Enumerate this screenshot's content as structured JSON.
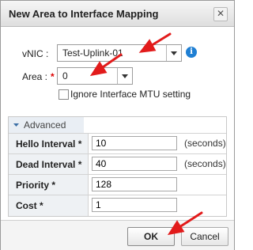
{
  "dialog": {
    "title": "New Area to Interface Mapping",
    "close_icon": "close-icon"
  },
  "form": {
    "vnic_label": "vNIC :",
    "vnic_value": "Test-Uplink-01",
    "area_label": "Area :",
    "area_required": "*",
    "area_value": "0",
    "ignore_mtu_label": "Ignore Interface MTU setting",
    "ignore_mtu_checked": false
  },
  "advanced": {
    "header": "Advanced",
    "expanded": true,
    "rows": [
      {
        "label": "Hello Interval *",
        "value": "10",
        "unit": "(seconds)"
      },
      {
        "label": "Dead Interval *",
        "value": "40",
        "unit": "(seconds)"
      },
      {
        "label": "Priority *",
        "value": "128",
        "unit": ""
      },
      {
        "label": "Cost *",
        "value": "1",
        "unit": ""
      }
    ]
  },
  "buttons": {
    "ok": "OK",
    "cancel": "Cancel"
  },
  "colors": {
    "accent_info": "#1f7fd3",
    "annotation_arrow": "#e21b1b",
    "required_marker": "#dd0000"
  }
}
